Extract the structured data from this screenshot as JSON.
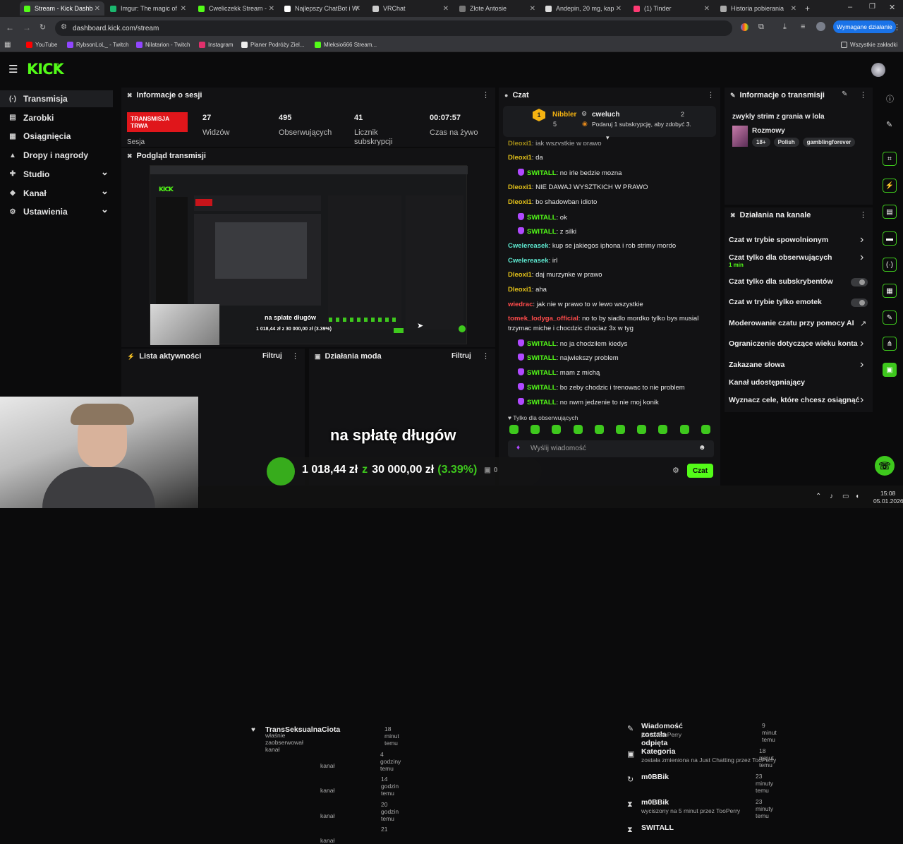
{
  "browser": {
    "tabs": [
      {
        "title": "Stream - Kick Dashb",
        "color": "#53fc18"
      },
      {
        "title": "Imgur: The magic of",
        "color": "#1bb76e"
      },
      {
        "title": "Cweliczekk Stream - ",
        "color": "#53fc18"
      },
      {
        "title": "Najlepszy ChatBot i W",
        "color": "#ffffff"
      },
      {
        "title": "VRChat",
        "color": "#cccccc"
      },
      {
        "title": "Złote Antosie",
        "color": "#777777"
      },
      {
        "title": "Andepin, 20 mg, kap",
        "color": "#dddddd"
      },
      {
        "title": "(1) Tinder",
        "color": "#fd3a73"
      },
      {
        "title": "Historia pobierania",
        "color": "#aaaaaa"
      }
    ],
    "url": "dashboard.kick.com/stream",
    "update_button": "Wymagane działanie",
    "bookmarks": [
      {
        "label": "YouTube",
        "color": "#ff0000"
      },
      {
        "label": "RybsonLoL_ - Twitch",
        "color": "#9146ff"
      },
      {
        "label": "Nilatarion - Twitch",
        "color": "#9146ff"
      },
      {
        "label": "Instagram",
        "color": "#e1306c"
      },
      {
        "label": "Planer Podróży Ziel...",
        "color": "#eeeeee"
      },
      {
        "label": "Mleksio666 Stream...",
        "color": "#53fc18"
      }
    ],
    "all_bookmarks": "Wszystkie zakładki"
  },
  "sidebar": {
    "items": [
      {
        "label": "Transmisja",
        "icon": "(·)"
      },
      {
        "label": "Zarobki",
        "icon": "▤"
      },
      {
        "label": "Osiągnięcia",
        "icon": "▦"
      },
      {
        "label": "Dropy i nagrody",
        "icon": "▲"
      },
      {
        "label": "Studio",
        "icon": "✚"
      },
      {
        "label": "Kanał",
        "icon": "◆"
      },
      {
        "label": "Ustawienia",
        "icon": "⚙"
      }
    ]
  },
  "session": {
    "title": "Informacje o sesji",
    "live_badge": "TRANSMISJA TRWA",
    "stats": [
      {
        "value": "27",
        "label": "Widzów"
      },
      {
        "value": "495",
        "label": "Obserwujących"
      },
      {
        "value": "41",
        "label": "Licznik subskrypcji"
      },
      {
        "value": "00:07:57",
        "label": "Czas na żywo"
      }
    ],
    "sesja_label": "Sesja"
  },
  "preview": {
    "title": "Podgląd transmisji",
    "overlay_text": "na splate długów",
    "overlay_money": "1 018,44 zł z 30 000,00 zł (3.39%)"
  },
  "activity": {
    "title": "Lista aktywności",
    "filter": "Filtruj",
    "items": [
      {
        "name": "TransSeksualnaCiota",
        "sub": "właśnie zaobserwował kanał",
        "time": "18 minut temu"
      },
      {
        "name": "",
        "sub": "kanał",
        "time": "4 godziny temu"
      },
      {
        "name": "",
        "sub": "kanał",
        "time": "14 godzin temu"
      },
      {
        "name": "",
        "sub": "kanał",
        "time": "20 godzin temu"
      },
      {
        "name": "",
        "sub": "kanał",
        "time": "21"
      }
    ]
  },
  "modactions": {
    "title": "Działania moda",
    "filter": "Filtruj",
    "items": [
      {
        "title": "Wiadomość została odpięta",
        "sub": "przez TooPerry",
        "time": "9 minut temu"
      },
      {
        "title": "Kategoria",
        "sub": "została zmieniona na Just Chatting przez TooPerry",
        "time": "18 minut temu"
      },
      {
        "title": "m0BBik",
        "sub": "",
        "time": "23 minuty temu"
      },
      {
        "title": "m0BBik",
        "sub": "wyciszony na 5 minut przez TooPerry",
        "time": "23 minuty temu"
      },
      {
        "title": "SWITALL",
        "sub": "",
        "time": ""
      }
    ]
  },
  "chat": {
    "title": "Czat",
    "pinned_top": {
      "user": "Nibbler",
      "count": "5",
      "user2": "cweluch",
      "count2": "2",
      "goal": "Podaruj 1 subskrypcję, aby zdobyć 3."
    },
    "messages": [
      {
        "user": "Dleoxi1",
        "color": "#e4c21a",
        "badge": false,
        "text": "jak wszystkie w prawo"
      },
      {
        "user": "Dleoxi1",
        "color": "#e4c21a",
        "badge": false,
        "text": "da"
      },
      {
        "user": "SWITALL",
        "color": "#53fc18",
        "badge": true,
        "text": "no irle bedzie mozna"
      },
      {
        "user": "Dleoxi1",
        "color": "#e4c21a",
        "badge": false,
        "text": "NIE DAWAJ WYSZTKICH W PRAWO"
      },
      {
        "user": "Dleoxi1",
        "color": "#e4c21a",
        "badge": false,
        "text": "bo shadowban idioto"
      },
      {
        "user": "SWITALL",
        "color": "#53fc18",
        "badge": true,
        "text": "ok"
      },
      {
        "user": "SWITALL",
        "color": "#53fc18",
        "badge": true,
        "text": "z silki"
      },
      {
        "user": "Cwelereasek",
        "color": "#5ee8d0",
        "badge": false,
        "text": "kup se jakiegos iphona i rob strimy mordo"
      },
      {
        "user": "Cwelereasek",
        "color": "#5ee8d0",
        "badge": false,
        "text": "irl"
      },
      {
        "user": "Dleoxi1",
        "color": "#e4c21a",
        "badge": false,
        "text": "daj murzynke w prawo"
      },
      {
        "user": "Dleoxi1",
        "color": "#e4c21a",
        "badge": false,
        "text": "aha"
      },
      {
        "user": "wiedrac",
        "color": "#ff4b4b",
        "badge": false,
        "text": "jak nie w prawo to w lewo wszystkie"
      },
      {
        "user": "tomek_lodyga_official",
        "color": "#ff4b4b",
        "badge": false,
        "text": "no to by siadlo mordko tylko bys musial"
      },
      {
        "user": "",
        "color": "#ffffff",
        "badge": false,
        "text": "trzymac miche i chocdzic chociaz 3x w tyg"
      },
      {
        "user": "SWITALL",
        "color": "#53fc18",
        "badge": true,
        "text": "no ja chodzilem kiedys"
      },
      {
        "user": "SWITALL",
        "color": "#53fc18",
        "badge": true,
        "text": "najwiekszy problem"
      },
      {
        "user": "SWITALL",
        "color": "#53fc18",
        "badge": true,
        "text": "mam z michą"
      },
      {
        "user": "SWITALL",
        "color": "#53fc18",
        "badge": true,
        "text": "bo zeby chodzic i trenowac to nie problem"
      },
      {
        "user": "SWITALL",
        "color": "#53fc18",
        "badge": true,
        "text": "no nwm jedzenie to nie moj konik"
      }
    ],
    "followers_only": "Tylko dla obserwujących",
    "input_placeholder": "Wyślij wiadomość",
    "send_button": "Czat"
  },
  "info": {
    "title": "Informacje o transmisji",
    "stream_title": "zwykly strim z grania w lola",
    "category": "Rozmowy",
    "tags": [
      "18+",
      "Polish",
      "gamblingforever"
    ]
  },
  "channel_actions": {
    "title": "Działania na kanale",
    "items": [
      {
        "label": "Czat w trybie spowolnionym",
        "sub": "",
        "control": "chevron"
      },
      {
        "label": "Czat tylko dla obserwujących",
        "sub": "1 min",
        "control": "chevron"
      },
      {
        "label": "Czat tylko dla subskrybentów",
        "sub": "",
        "control": "toggle"
      },
      {
        "label": "Czat w trybie tylko emotek",
        "sub": "",
        "control": "toggle"
      },
      {
        "label": "Moderowanie czatu przy pomocy AI",
        "sub": "",
        "control": "external"
      },
      {
        "label": "Ograniczenie dotyczące wieku konta",
        "sub": "",
        "control": "chevron"
      },
      {
        "label": "Zakazane słowa",
        "sub": "",
        "control": "chevron"
      },
      {
        "label": "Kanał udostępniający",
        "sub": "",
        "control": "none"
      },
      {
        "label": "Wyznacz cele, które chcesz osiągnąć",
        "sub": "",
        "control": "chevron"
      }
    ]
  },
  "overlay": {
    "caption": "na spłatę długów",
    "money": "1 018,44 zł",
    "z": "z",
    "goal": "30 000,00 zł",
    "percent": "(3.39%)",
    "count": "0"
  },
  "taskbar": {
    "time": "15:08",
    "date": "05.01.2026"
  },
  "colors": {
    "accent": "#53fc18",
    "live": "#e0161b",
    "bg": "#0b0b0c",
    "panel": "#121214"
  }
}
